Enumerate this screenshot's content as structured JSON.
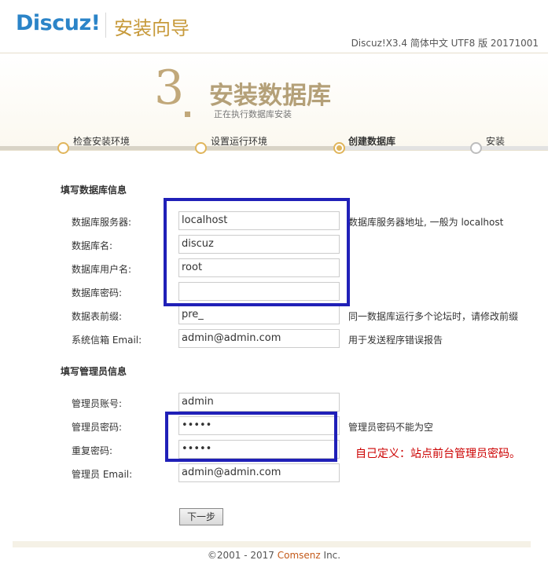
{
  "header": {
    "logo_text": "Discuz!",
    "logo_sub": "安装向导",
    "version": "Discuz!X3.4 简体中文 UTF8 版 20171001"
  },
  "step": {
    "number": "3",
    "title": "安装数据库",
    "subtitle": "正在执行数据库安装"
  },
  "progress": [
    {
      "label": "检查安装环境",
      "state": "done"
    },
    {
      "label": "设置运行环境",
      "state": "done"
    },
    {
      "label": "创建数据库",
      "state": "current"
    },
    {
      "label": "安装",
      "state": "future"
    }
  ],
  "db_section": {
    "title": "填写数据库信息",
    "fields": [
      {
        "label": "数据库服务器:",
        "value": "localhost",
        "hint": "数据库服务器地址, 一般为 localhost"
      },
      {
        "label": "数据库名:",
        "value": "discuz",
        "hint": ""
      },
      {
        "label": "数据库用户名:",
        "value": "root",
        "hint": ""
      },
      {
        "label": "数据库密码:",
        "value": "",
        "hint": ""
      },
      {
        "label": "数据表前缀:",
        "value": "pre_",
        "hint": "同一数据库运行多个论坛时，请修改前缀"
      },
      {
        "label": "系统信箱 Email:",
        "value": "admin@admin.com",
        "hint": "用于发送程序错误报告"
      }
    ]
  },
  "admin_section": {
    "title": "填写管理员信息",
    "fields": [
      {
        "label": "管理员账号:",
        "value": "admin",
        "hint": ""
      },
      {
        "label": "管理员密码:",
        "value": "•••••",
        "hint": "管理员密码不能为空"
      },
      {
        "label": "重复密码:",
        "value": "•••••",
        "hint": ""
      },
      {
        "label": "管理员 Email:",
        "value": "admin@admin.com",
        "hint": ""
      }
    ]
  },
  "annotation": "自己定义：站点前台管理员密码。",
  "next_button": "下一步",
  "footer": {
    "copyright": "©2001 - 2017 ",
    "brand": "Comsenz",
    "suffix": " Inc."
  }
}
